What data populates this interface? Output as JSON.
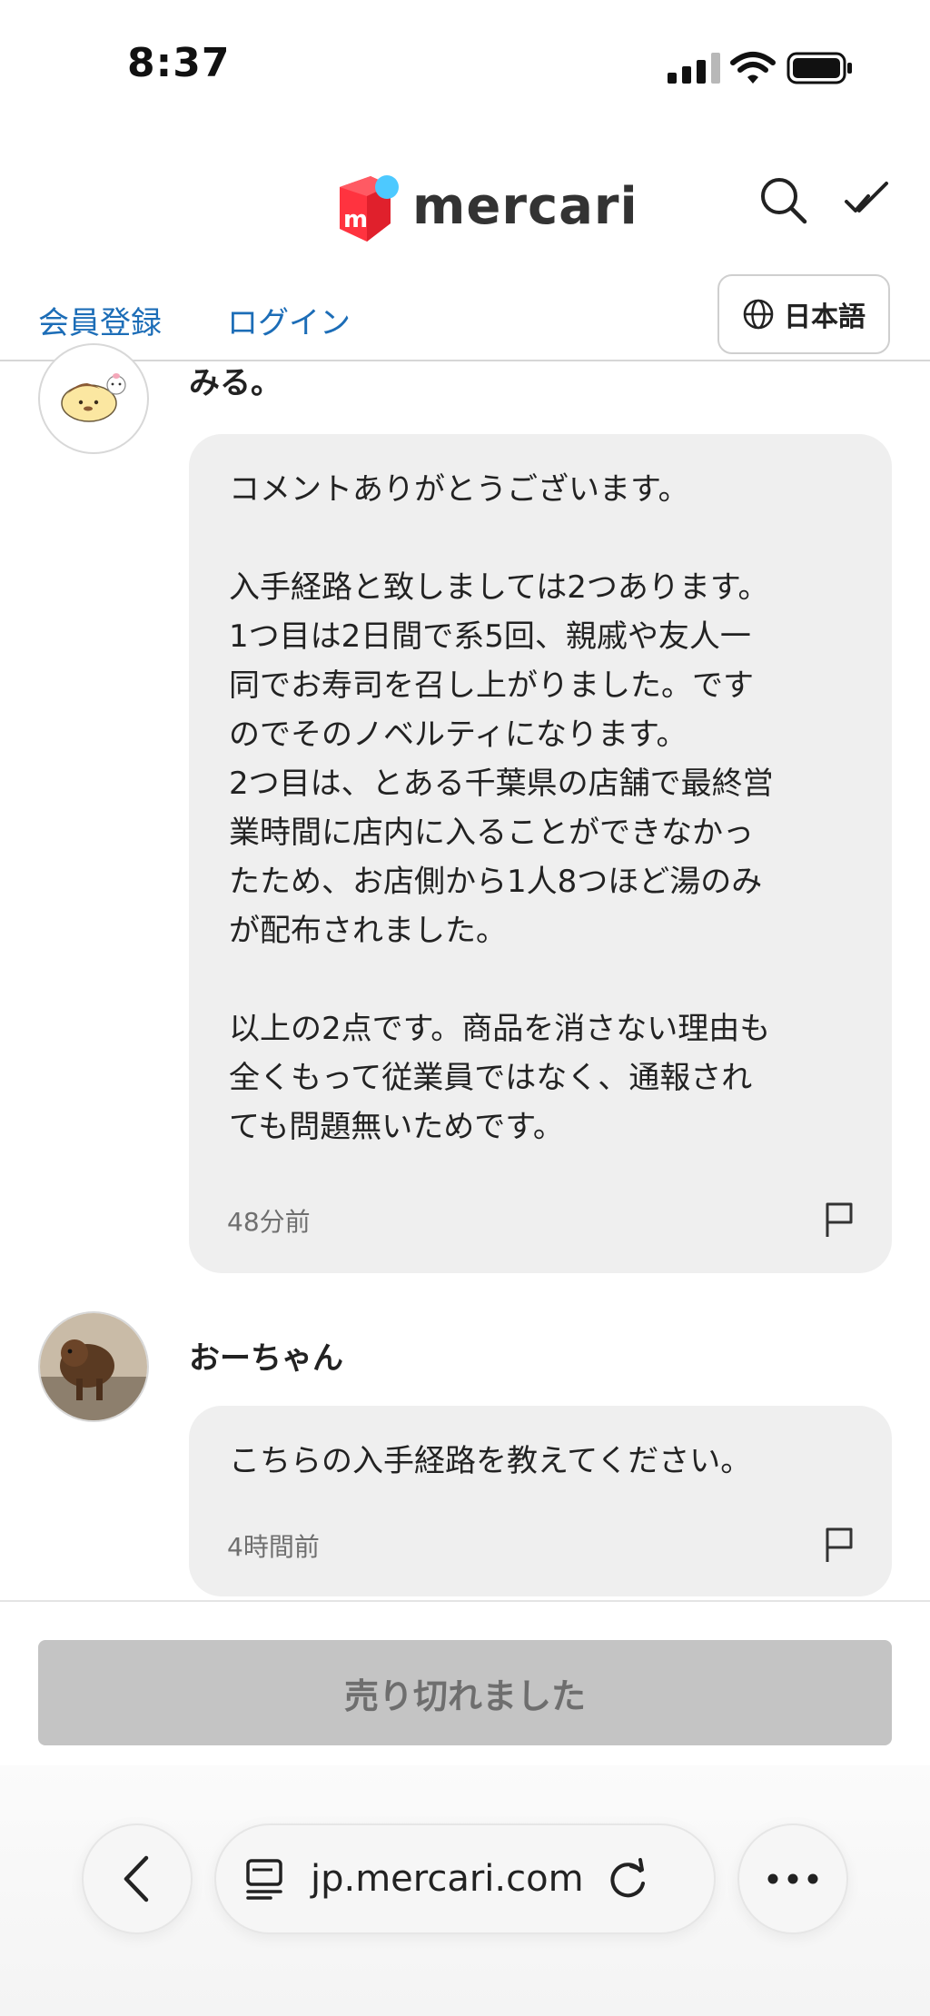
{
  "status_bar": {
    "time": "8:37"
  },
  "header": {
    "logo_text": "mercari",
    "logo_letter": "m"
  },
  "nav": {
    "register": "会員登録",
    "login": "ログイン",
    "language": "日本語"
  },
  "comments": [
    {
      "username": "みる。",
      "text": "コメントありがとうございます。\n\n入手経路と致しましては2つあります。\n1つ目は2日間で系5回、親戚や友人一\n同でお寿司を召し上がりました。です\nのでそのノベルティになります。\n2つ目は、とある千葉県の店舗で最終営\n業時間に店内に入ることができなかっ\nたため、お店側から1人8つほど湯のみ\nが配布されました。\n\n以上の2点です。商品を消さない理由も\n全くもって従業員ではなく、通報され\nても問題無いためです。",
      "time": "48分前"
    },
    {
      "username": "おーちゃん",
      "text": "こちらの入手経路を教えてください。",
      "time": "4時間前"
    }
  ],
  "purchase": {
    "soldout_label": "売り切れました"
  },
  "browser": {
    "url": "jp.mercari.com"
  },
  "colors": {
    "brand_red": "#ff333f",
    "brand_blue": "#4dc9ff",
    "link": "#1c6db7"
  }
}
